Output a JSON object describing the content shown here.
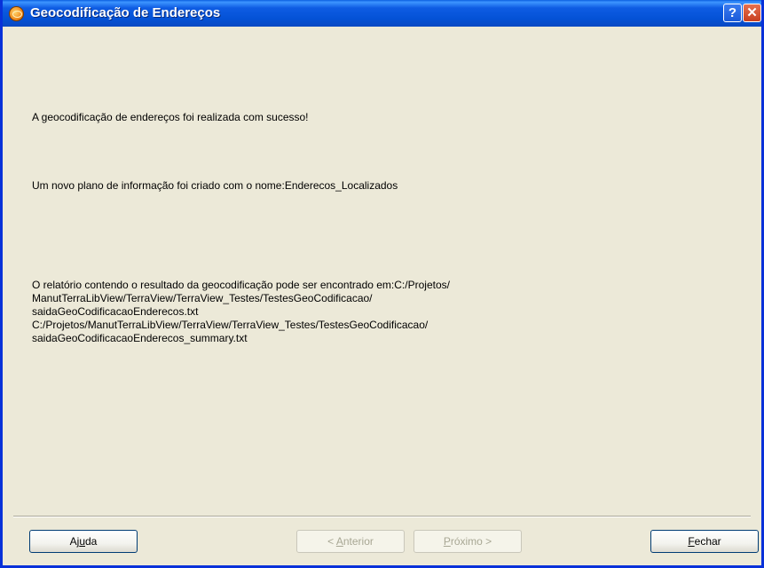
{
  "window": {
    "title": "Geocodificação de Endereços",
    "help_label": "?",
    "close_label": "✕"
  },
  "messages": {
    "success": "A geocodificação de endereços foi realizada com sucesso!",
    "layer_created": "Um novo plano de informação foi criado com o nome:Enderecos_Localizados",
    "report_lines": [
      "O relatório contendo o resultado da geocodificação pode ser encontrado em:C:/Projetos/",
      "ManutTerraLibView/TerraView/TerraView_Testes/TestesGeoCodificacao/",
      "saidaGeoCodificacaoEnderecos.txt",
      "C:/Projetos/ManutTerraLibView/TerraView/TerraView_Testes/TestesGeoCodificacao/",
      "saidaGeoCodificacaoEnderecos_summary.txt"
    ]
  },
  "buttons": {
    "ajuda": {
      "pre": "Aj",
      "key": "u",
      "post": "da",
      "enabled": true
    },
    "anterior": {
      "pre": "< ",
      "key": "A",
      "post": "nterior",
      "enabled": false
    },
    "proximo": {
      "pre": "",
      "key": "P",
      "post": "róximo >",
      "enabled": false
    },
    "fechar": {
      "pre": "",
      "key": "F",
      "post": "echar",
      "enabled": true
    }
  }
}
